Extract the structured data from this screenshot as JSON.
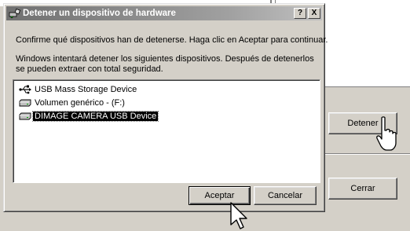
{
  "dialog": {
    "title": "Detener un dispositivo de hardware",
    "help_label": "?",
    "close_label": "X",
    "message1": "Confirme qué dispositivos han de detenerse. Haga clic en Aceptar para continuar.",
    "message2": "Windows intentará detener los siguientes dispositivos. Después de detenerlos se pueden extraer con total seguridad.",
    "devices": [
      {
        "label": "USB Mass Storage Device",
        "icon": "usb-icon"
      },
      {
        "label": "Volumen genérico - (F:)",
        "icon": "drive-icon"
      },
      {
        "label": "DIMAGE CAMERA USB Device",
        "icon": "drive-icon",
        "selected": true
      }
    ],
    "ok_label": "Aceptar",
    "cancel_label": "Cancelar"
  },
  "background": {
    "stop_label": "Detener",
    "close_label": "Cerrar"
  }
}
